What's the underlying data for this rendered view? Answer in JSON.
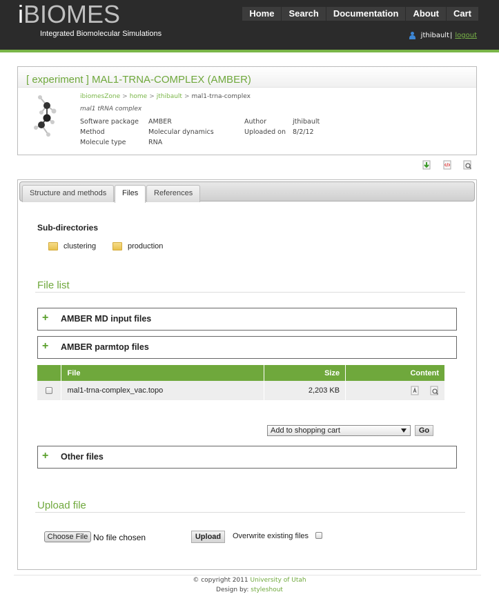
{
  "header": {
    "logo_first": "i",
    "logo_rest": "BIOMES",
    "slogan": "Integrated Biomolecular Simulations",
    "nav": [
      "Home",
      "Search",
      "Documentation",
      "About",
      "Cart"
    ],
    "username": "jthibault",
    "separator": "|",
    "logout": "logout"
  },
  "experiment": {
    "title": "[ experiment ] MAL1-TRNA-COMPLEX (AMBER)",
    "breadcrumb": [
      "ibiomesZone",
      "home",
      "jthibault",
      "mal1-trna-complex"
    ],
    "breadcrumb_sep": ">",
    "description": "mal1 tRNA complex",
    "software_label": "Software package",
    "software_value": "AMBER",
    "method_label": "Method",
    "method_value": "Molecular dynamics",
    "molecule_label": "Molecule type",
    "molecule_value": "RNA",
    "author_label": "Author",
    "author_value": "jthibault",
    "uploaded_label": "Uploaded on",
    "uploaded_value": "8/2/12"
  },
  "tools": [
    "download-icon",
    "xml-icon",
    "view-icon"
  ],
  "tabs": [
    "Structure and methods",
    "Files",
    "References"
  ],
  "active_tab": "Files",
  "subdirs": {
    "title": "Sub-directories",
    "items": [
      "clustering",
      "production"
    ]
  },
  "file_list": {
    "title": "File list",
    "groups": [
      "AMBER MD input files",
      "AMBER parmtop files",
      "Other files"
    ],
    "expand_symbol": "+",
    "columns": [
      "File",
      "Size",
      "Content"
    ],
    "rows": [
      {
        "name": "mal1-trna-complex_vac.topo",
        "size": "2,203 KB"
      }
    ],
    "action_select": "Add to shopping cart",
    "go_button": "Go"
  },
  "upload": {
    "title": "Upload file",
    "choose_button": "Choose File",
    "no_file": "No file chosen",
    "upload_button": "Upload",
    "overwrite_label": "Overwrite existing files"
  },
  "footer": {
    "copyright_prefix": "© copyright 2011",
    "copyright_link": "University of Utah",
    "design_prefix": "Design by:",
    "design_link": "styleshout"
  },
  "colors": {
    "accent": "#6fa83c",
    "header_bg": "#2b2b2b"
  }
}
